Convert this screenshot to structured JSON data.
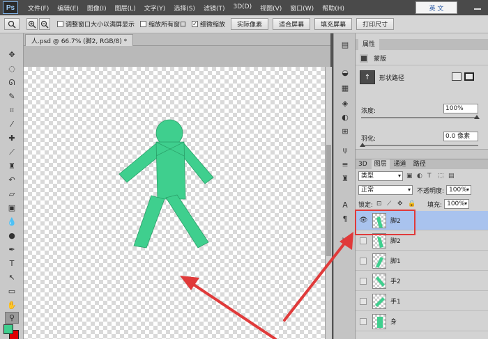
{
  "app": {
    "logo": "Ps",
    "menu": [
      "文件(F)",
      "编辑(E)",
      "图像(I)",
      "图层(L)",
      "文字(Y)",
      "选择(S)",
      "滤镜(T)",
      "3D(D)",
      "视图(V)",
      "窗口(W)",
      "帮助(H)"
    ],
    "ime_label": "英 文"
  },
  "options_bar": {
    "checkbox_resize": "调整窗口大小以满屏显示",
    "checkbox_zoom_all": "缩放所有窗口",
    "checkbox_scrubby": "细微缩放",
    "btn_actual": "实际像素",
    "btn_fit": "适合屏幕",
    "btn_fill": "填充屏幕",
    "btn_print": "打印尺寸"
  },
  "document": {
    "tab_title": "人.psd @ 66.7% (脚2, RGB/8) *"
  },
  "properties": {
    "tab": "属性",
    "mask_label": "蒙版",
    "shape_label": "形状路径",
    "density_label": "浓度:",
    "density_value": "100%",
    "feather_label": "羽化:",
    "feather_value": "0.0 像素"
  },
  "layers": {
    "tabs": [
      "3D",
      "图层",
      "通道",
      "路径"
    ],
    "filter_label": "类型",
    "blend_mode": "正常",
    "opacity_label": "不透明度:",
    "opacity_value": "100%",
    "lock_label": "锁定:",
    "fill_label": "填充:",
    "fill_value": "100%",
    "items": [
      {
        "name": "脚2",
        "visible": true,
        "selected": true
      },
      {
        "name": "脚2",
        "visible": false,
        "selected": false
      },
      {
        "name": "脚1",
        "visible": false,
        "selected": false
      },
      {
        "name": "手2",
        "visible": false,
        "selected": false
      },
      {
        "name": "手1",
        "visible": false,
        "selected": false
      },
      {
        "name": "身",
        "visible": false,
        "selected": false
      }
    ]
  },
  "colors": {
    "figure": "#3fcf8e",
    "figure_stroke": "#2a9f68",
    "foreground": "#3fcf8e",
    "background": "#e00000",
    "highlight": "#e03a3a"
  }
}
